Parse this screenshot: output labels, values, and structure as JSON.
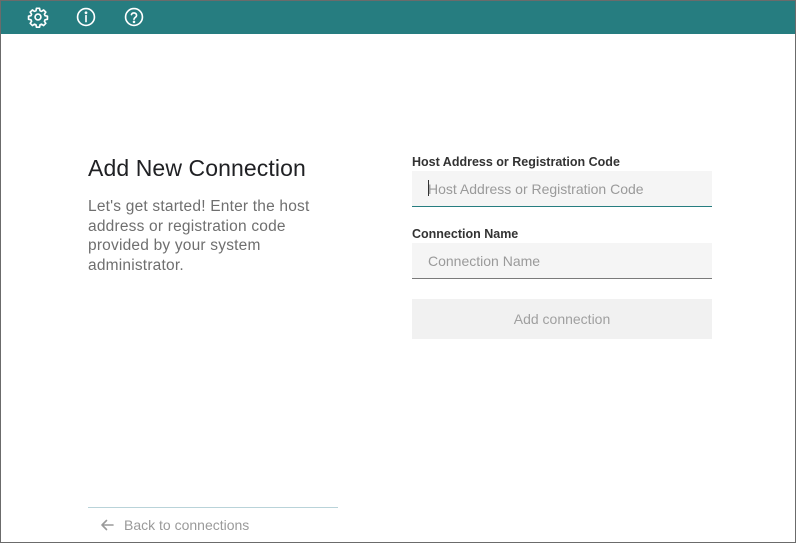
{
  "topbar": {
    "color": "#267d80",
    "icons": [
      "gear-icon",
      "info-icon",
      "help-icon"
    ]
  },
  "main": {
    "title": "Add New Connection",
    "description": "Let's get started! Enter the host address or registration code provided by your system administrator."
  },
  "form": {
    "host": {
      "label": "Host Address or Registration Code",
      "placeholder": "Host Address or Registration Code",
      "value": ""
    },
    "name": {
      "label": "Connection Name",
      "placeholder": "Connection Name",
      "value": ""
    },
    "submit_label": "Add connection"
  },
  "footer": {
    "back_label": "Back to connections",
    "back_icon": "arrow-left-icon"
  }
}
